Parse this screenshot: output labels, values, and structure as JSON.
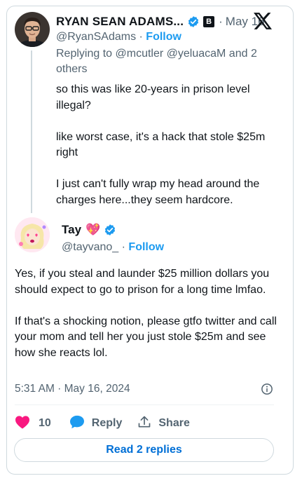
{
  "parent_tweet": {
    "display_name": "RYAN SEAN ADAMS...",
    "separator": "·",
    "date": "May 16",
    "handle": "@RyanSAdams",
    "follow_separator": "·",
    "follow_label": "Follow",
    "replying_to": "Replying to @mcutler @yeluacaM and 2 others",
    "text_lines": [
      "so this was like 20-years in prison level illegal?",
      "like worst case, it's a hack that stole $25m right",
      "I just can't fully wrap my head around the charges here...they seem hardcore."
    ],
    "badge_letter": "B"
  },
  "reply_tweet": {
    "display_name": "Tay",
    "name_emoji": "💖",
    "handle": "@tayvano_",
    "follow_separator": "·",
    "follow_label": "Follow",
    "text_paragraphs": [
      "Yes, if you steal and launder $25 million dollars you should expect to go to prison for a long time lmfao.",
      "If that's a shocking notion, please gtfo twitter and call your mom and tell her you just stole $25m and see how she reacts lol."
    ],
    "timestamp": "5:31 AM · May 16, 2024"
  },
  "actions": {
    "like_count": "10",
    "reply_label": "Reply",
    "share_label": "Share"
  },
  "read_replies_label": "Read 2 replies",
  "colors": {
    "accent_blue": "#1d9bf0",
    "link_blue": "#006fd6",
    "like_pink": "#f91880",
    "muted": "#536471",
    "border": "#cfd9de"
  },
  "icons": [
    "verified-badge-icon",
    "x-logo-icon",
    "info-icon",
    "heart-icon",
    "reply-bubble-icon",
    "share-icon"
  ]
}
